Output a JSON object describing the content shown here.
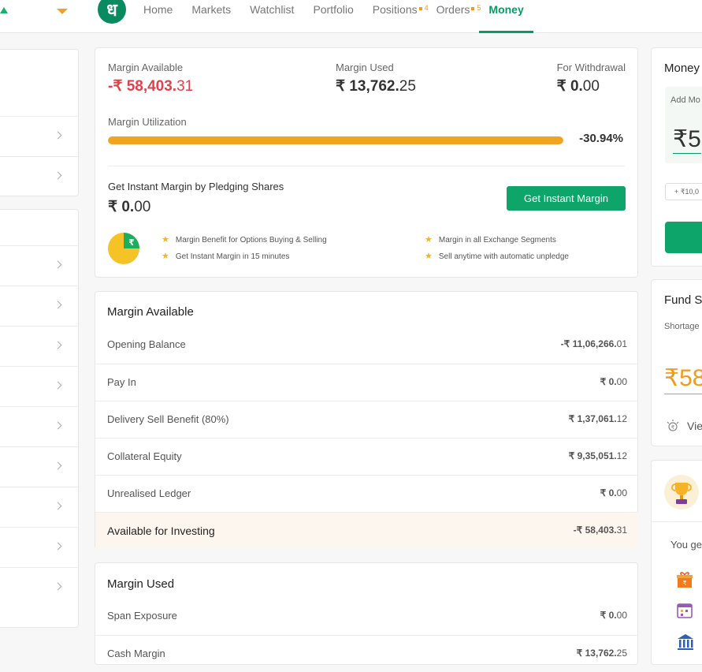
{
  "nav": {
    "logo": "ध",
    "items": [
      {
        "label": "Home"
      },
      {
        "label": "Markets"
      },
      {
        "label": "Watchlist"
      },
      {
        "label": "Portfolio"
      },
      {
        "label": "Positions",
        "badge": "4"
      },
      {
        "label": "Orders",
        "badge": "5"
      },
      {
        "label": "Money",
        "active": true
      }
    ]
  },
  "summary": {
    "margin_available_label": "Margin Available",
    "margin_available_int": "-₹ 58,403.",
    "margin_available_dec": "31",
    "margin_used_label": "Margin Used",
    "margin_used_int": "₹ 13,762.",
    "margin_used_dec": "25",
    "withdrawal_label": "For Withdrawal",
    "withdrawal_int": "₹ 0.",
    "withdrawal_dec": "00",
    "utilization_label": "Margin Utilization",
    "utilization_value": "-30.94%",
    "pledge_title": "Get Instant Margin by Pledging Shares",
    "pledge_amount_int": "₹ 0.",
    "pledge_amount_dec": "00",
    "pledge_button": "Get Instant Margin",
    "benefits": [
      "Margin Benefit for Options Buying & Selling",
      "Get Instant Margin in 15 minutes",
      "Margin in all Exchange Segments",
      "Sell anytime with automatic unpledge"
    ]
  },
  "margin_available": {
    "title": "Margin Available",
    "rows": [
      {
        "label": "Opening Balance",
        "int": "-₹ 11,06,266.",
        "dec": "01",
        "negative": true
      },
      {
        "label": "Pay In",
        "int": "₹ 0.",
        "dec": "00"
      },
      {
        "label": "Delivery Sell Benefit (80%)",
        "int": "₹ 1,37,061.",
        "dec": "12"
      },
      {
        "label": "Collateral Equity",
        "int": "₹ 9,35,051.",
        "dec": "12"
      },
      {
        "label": "Unrealised Ledger",
        "int": "₹ 0.",
        "dec": "00"
      },
      {
        "label": "Available for Investing",
        "int": "-₹ 58,403.",
        "dec": "31",
        "negative": true
      }
    ]
  },
  "margin_used": {
    "title": "Margin Used",
    "rows": [
      {
        "label": "Span Exposure",
        "int": "₹ 0.",
        "dec": "00"
      },
      {
        "label": "Cash Margin",
        "int": "₹ 13,762.",
        "dec": "25"
      }
    ]
  },
  "right": {
    "money_title": "Money",
    "add_money_label": "Add Mo",
    "amount_prefix": "₹5",
    "quick_add": "+ ₹10,0",
    "fund_title": "Fund S",
    "shortage_label": "Shortage",
    "shortage_value": "₹58",
    "view_label": "Vie",
    "you_get": "You ge"
  },
  "colors": {
    "brand_green": "#0a9b62",
    "negative_red": "#e0424a",
    "progress_orange": "#f2a41e"
  }
}
